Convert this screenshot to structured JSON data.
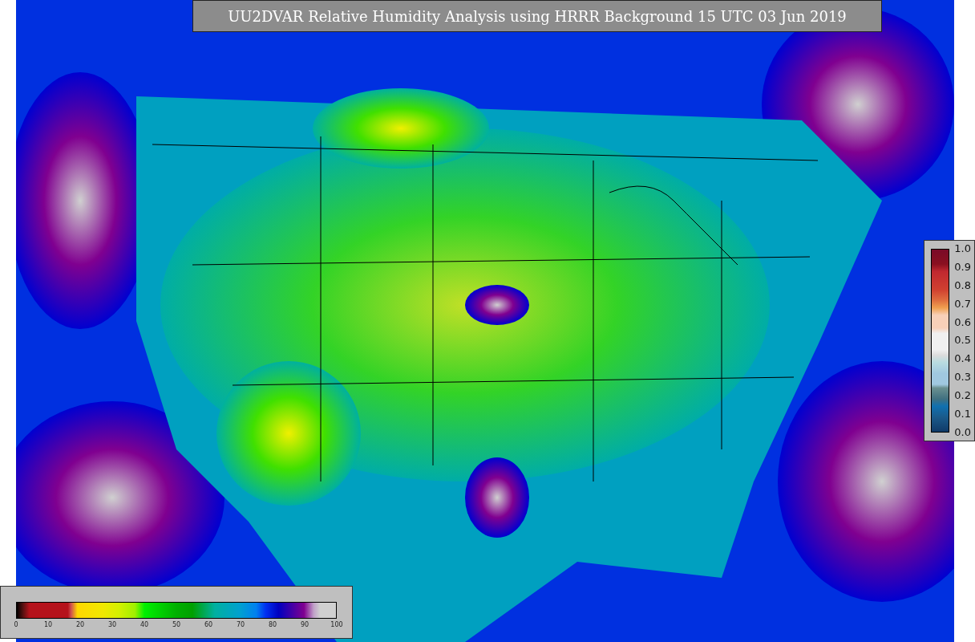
{
  "title": "UU2DVAR Relative Humidity Analysis using HRRR Background 15 UTC 03 Jun 2019",
  "humidity_colorbar": {
    "ticks": [
      "0",
      "10",
      "20",
      "30",
      "40",
      "50",
      "60",
      "70",
      "80",
      "90",
      "100"
    ]
  },
  "observation_colorbar": {
    "ticks": [
      "1.0",
      "0.9",
      "0.8",
      "0.7",
      "0.6",
      "0.5",
      "0.4",
      "0.3",
      "0.2",
      "0.1",
      "0.0"
    ]
  }
}
